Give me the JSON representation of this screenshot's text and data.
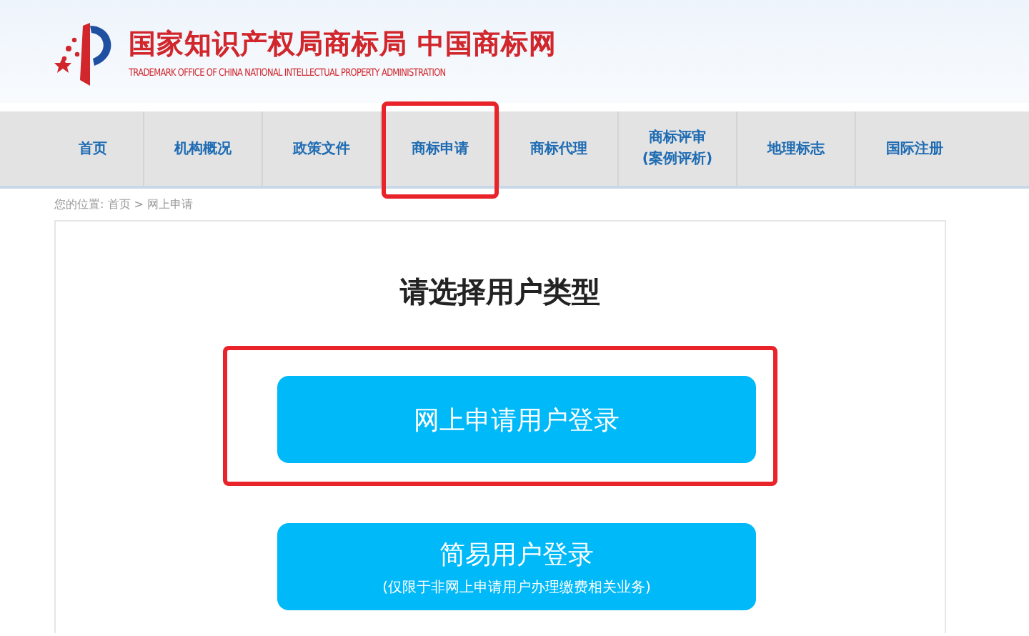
{
  "header": {
    "title": "国家知识产权局商标局 中国商标网",
    "subtitle": "TRADEMARK OFFICE OF CHINA NATIONAL INTELLECTUAL PROPERTY ADMINISTRATION"
  },
  "nav": [
    {
      "label": "首页",
      "highlighted": false
    },
    {
      "label": "机构概况",
      "highlighted": false
    },
    {
      "label": "政策文件",
      "highlighted": false
    },
    {
      "label": "商标申请",
      "highlighted": true
    },
    {
      "label": "商标代理",
      "highlighted": false
    },
    {
      "label": "商标评审",
      "sub": "(案例评析)",
      "highlighted": false
    },
    {
      "label": "地理标志",
      "highlighted": false
    },
    {
      "label": "国际注册",
      "highlighted": false
    }
  ],
  "breadcrumb": {
    "prefix": "您的位置:",
    "items": [
      "首页",
      "网上申请"
    ],
    "separator": ">"
  },
  "panel": {
    "title": "请选择用户类型",
    "buttons": [
      {
        "label": "网上申请用户登录",
        "highlighted": true
      },
      {
        "label": "简易用户登录",
        "note": "(仅限于非网上申请用户办理缴费相关业务)",
        "highlighted": false
      }
    ]
  }
}
